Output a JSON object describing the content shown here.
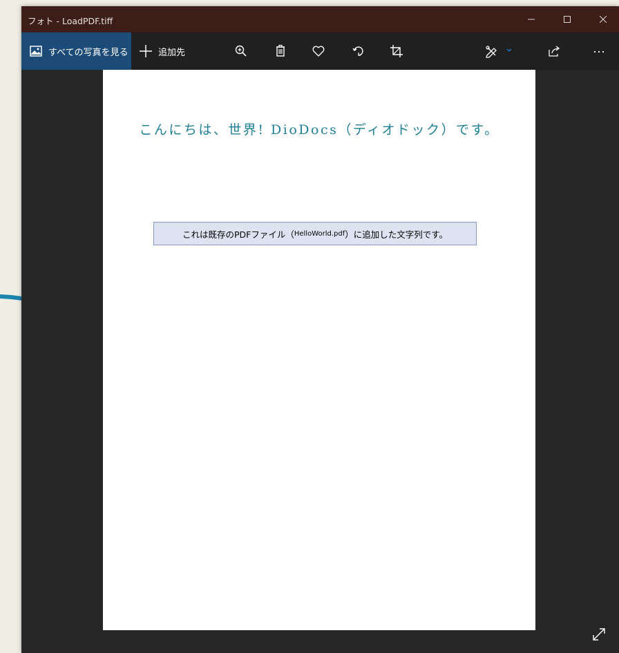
{
  "window": {
    "title": "フォト - LoadPDF.tiff"
  },
  "toolbar": {
    "all_photos_label": "すべての写真を見る",
    "add_to_label": "追加先"
  },
  "document": {
    "heading": "こんにちは、世界! DioDocs（ディオドック）です。",
    "textbox_prefix": "これは既存のPDFファイル（",
    "textbox_file": "HelloWorld.pdf",
    "textbox_suffix": "）に追加した文字列です。"
  },
  "colors": {
    "titlebar_bg": "#3d1d18",
    "toolbar_bg": "#202020",
    "all_photos_bg": "#1d4b78",
    "viewer_bg": "#262626",
    "heading_color": "#1f7f95",
    "textbox_bg": "#dde3f1",
    "textbox_border": "#8797c3",
    "annotation_arrow": "#1b86ad",
    "page_bg": "#f0ede4"
  },
  "icons": {
    "minimize": "minimize-icon",
    "maximize": "maximize-icon",
    "close": "close-icon",
    "all_photos": "image-icon",
    "add": "plus-icon",
    "zoom": "zoom-in-icon",
    "delete": "trash-icon",
    "favorite": "heart-icon",
    "rotate": "rotate-icon",
    "crop": "crop-icon",
    "edit": "edit-create-icon",
    "share": "share-icon",
    "more": "more-icon",
    "fullscreen": "expand-icon"
  }
}
